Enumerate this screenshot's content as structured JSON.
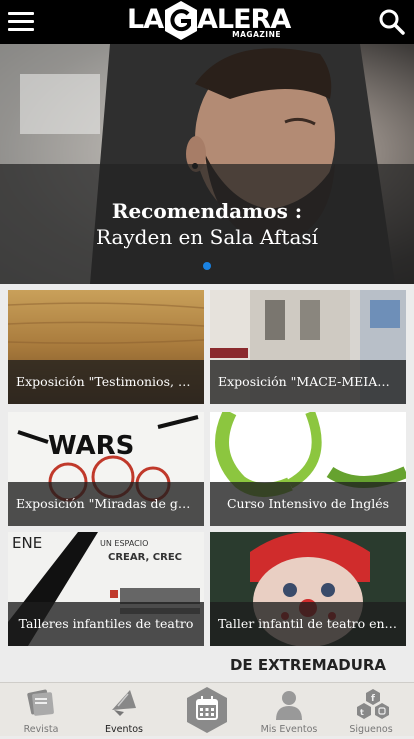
{
  "header": {
    "brand_left": "LA",
    "brand_right": "ALERA",
    "brand_sub": "MAGAZINE",
    "menu_icon": "hamburger-icon",
    "search_icon": "search-icon"
  },
  "hero": {
    "title": "Recomendamos :",
    "subtitle": "Rayden en Sala Aftasí",
    "active_dot_color": "#1a82e2"
  },
  "cards": [
    {
      "caption": "Exposición \"Testimonios, herramientas y oficios\""
    },
    {
      "caption": "Exposición \"MACE-MEIAC Intercambio de colecciones\""
    },
    {
      "caption": "Exposición \"Miradas de guerra\""
    },
    {
      "caption": "Curso Intensivo de Inglés"
    },
    {
      "caption": "Talleres infantiles de teatro"
    },
    {
      "caption": "Taller infantil de teatro en Cáceres"
    }
  ],
  "partial_card": {
    "banner_text": "DE EXTREMADURA"
  },
  "nav": {
    "items": [
      {
        "label": "Revista",
        "icon": "magazine-icon"
      },
      {
        "label": "Eventos",
        "icon": "megaphone-icon"
      },
      {
        "label": "",
        "icon": "calendar-icon"
      },
      {
        "label": "Mis Eventos",
        "icon": "user-icon"
      },
      {
        "label": "Siguenos",
        "icon": "social-icon"
      }
    ]
  }
}
